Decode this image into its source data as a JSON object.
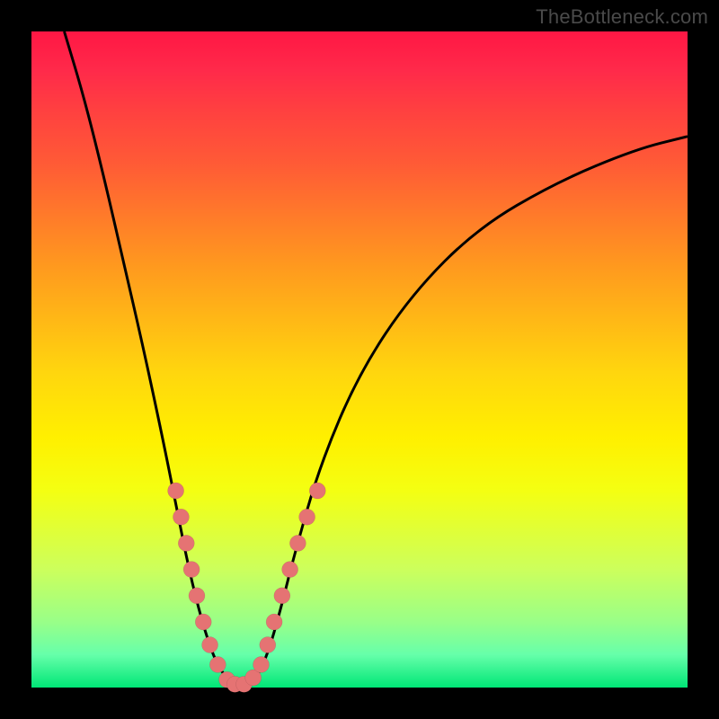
{
  "watermark": "TheBottleneck.com",
  "chart_data": {
    "type": "line",
    "title": "",
    "xlabel": "",
    "ylabel": "",
    "xlim": [
      0,
      100
    ],
    "ylim": [
      0,
      100
    ],
    "series": [
      {
        "name": "bottleneck-curve",
        "points": [
          {
            "x": 5,
            "y": 100
          },
          {
            "x": 8,
            "y": 90
          },
          {
            "x": 11,
            "y": 78
          },
          {
            "x": 14,
            "y": 65
          },
          {
            "x": 17,
            "y": 52
          },
          {
            "x": 20,
            "y": 38
          },
          {
            "x": 22,
            "y": 28
          },
          {
            "x": 24,
            "y": 18
          },
          {
            "x": 26,
            "y": 10
          },
          {
            "x": 28,
            "y": 4
          },
          {
            "x": 30,
            "y": 1
          },
          {
            "x": 32,
            "y": 0
          },
          {
            "x": 34,
            "y": 1
          },
          {
            "x": 36,
            "y": 5
          },
          {
            "x": 38,
            "y": 12
          },
          {
            "x": 40,
            "y": 20
          },
          {
            "x": 44,
            "y": 34
          },
          {
            "x": 50,
            "y": 48
          },
          {
            "x": 58,
            "y": 60
          },
          {
            "x": 68,
            "y": 70
          },
          {
            "x": 80,
            "y": 77
          },
          {
            "x": 92,
            "y": 82
          },
          {
            "x": 100,
            "y": 84
          }
        ]
      }
    ],
    "markers": {
      "name": "highlighted-dots",
      "color": "#e57373",
      "points": [
        {
          "x": 22.0,
          "y": 30
        },
        {
          "x": 22.8,
          "y": 26
        },
        {
          "x": 23.6,
          "y": 22
        },
        {
          "x": 24.4,
          "y": 18
        },
        {
          "x": 25.2,
          "y": 14
        },
        {
          "x": 26.2,
          "y": 10
        },
        {
          "x": 27.2,
          "y": 6.5
        },
        {
          "x": 28.4,
          "y": 3.5
        },
        {
          "x": 29.8,
          "y": 1.2
        },
        {
          "x": 31.0,
          "y": 0.5
        },
        {
          "x": 32.4,
          "y": 0.5
        },
        {
          "x": 33.8,
          "y": 1.5
        },
        {
          "x": 35.0,
          "y": 3.5
        },
        {
          "x": 36.0,
          "y": 6.5
        },
        {
          "x": 37.0,
          "y": 10
        },
        {
          "x": 38.2,
          "y": 14
        },
        {
          "x": 39.4,
          "y": 18
        },
        {
          "x": 40.6,
          "y": 22
        },
        {
          "x": 42.0,
          "y": 26
        },
        {
          "x": 43.6,
          "y": 30
        }
      ]
    },
    "background_gradient": {
      "top": "#ff1744",
      "bottom": "#00e676"
    }
  }
}
